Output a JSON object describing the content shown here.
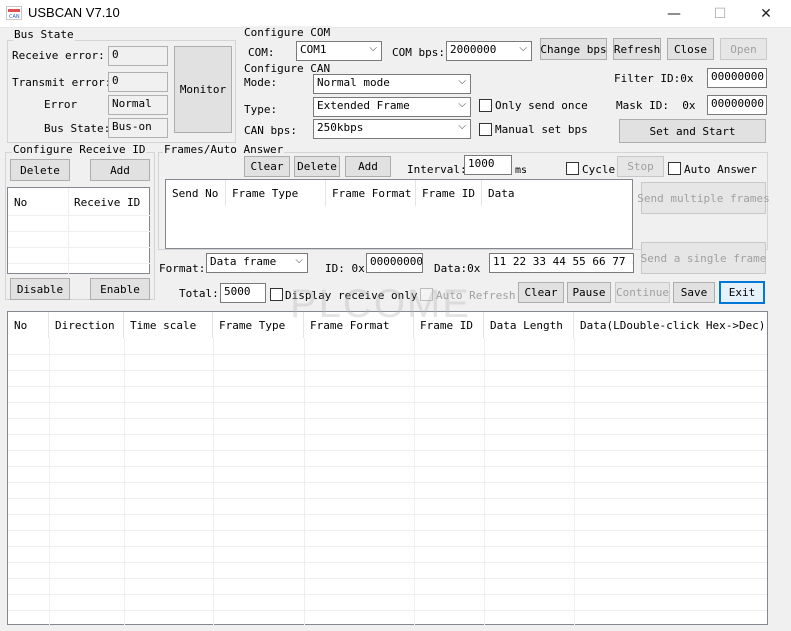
{
  "window": {
    "title": "USBCAN V7.10",
    "icon_name": "usbcan-app-icon",
    "icon_text": "CAN",
    "minimize_glyph": "—",
    "maximize_glyph": "☐",
    "close_glyph": "✕"
  },
  "bus_state": {
    "group_label": "Bus State",
    "receive_error_label": "Receive error:",
    "receive_error_value": "0",
    "transmit_error_label": "Transmit error:",
    "transmit_error_value": "0",
    "error_label": "Error",
    "error_value": "Normal",
    "bus_state_label": "Bus State:",
    "bus_state_value": "Bus-on",
    "monitor_button": "Monitor"
  },
  "configure_com": {
    "group_label": "Configure COM",
    "com_label": "COM:",
    "com_value": "COM1",
    "com_bps_label": "COM bps:",
    "com_bps_value": "2000000",
    "change_bps_button": "Change bps",
    "refresh_button": "Refresh",
    "close_button": "Close",
    "open_button": "Open"
  },
  "configure_can": {
    "group_label": "Configure CAN",
    "mode_label": "Mode:",
    "mode_value": "Normal mode",
    "type_label": "Type:",
    "type_value": "Extended Frame",
    "can_bps_label": "CAN bps:",
    "can_bps_value": "250kbps",
    "only_send_once_label": "Only send once",
    "manual_set_bps_label": "Manual set bps",
    "filter_id_label": "Filter ID:0x",
    "filter_id_value": "00000000",
    "mask_id_label": "Mask ID:  0x",
    "mask_id_value": "00000000",
    "set_and_start_button": "Set and Start"
  },
  "configure_receive_id": {
    "group_label": "Configure Receive ID",
    "delete_button": "Delete",
    "add_button": "Add",
    "columns": [
      "No",
      "Receive ID"
    ],
    "disable_button": "Disable",
    "enable_button": "Enable"
  },
  "frames_auto_answer": {
    "group_label": "Frames/Auto Answer",
    "clear_button": "Clear",
    "delete_button": "Delete",
    "add_button": "Add",
    "interval_label": "Interval:",
    "interval_value": "1000",
    "interval_unit": "ms",
    "cycle_label": "Cycle",
    "stop_button": "Stop",
    "auto_answer_label": "Auto Answer",
    "columns": [
      "Send No",
      "Frame Type",
      "Frame Format",
      "Frame ID",
      "Data"
    ],
    "send_multiple_button": "Send multiple frames",
    "send_single_button": "Send a single frame"
  },
  "send_bar": {
    "format_label": "Format:",
    "format_value": "Data frame",
    "id_label": "ID: 0x",
    "id_value": "00000000",
    "data_label": "Data:0x",
    "data_value": "11 22 33 44 55 66 77 88"
  },
  "receive_bar": {
    "total_label": "Total:",
    "total_value": "5000",
    "display_receive_only_label": "Display receive only",
    "auto_refresh_label": "Auto Refresh",
    "clear_button": "Clear",
    "pause_button": "Pause",
    "continue_button": "Continue",
    "save_button": "Save",
    "exit_button": "Exit"
  },
  "receive_table": {
    "columns": [
      "No",
      "Direction",
      "Time scale",
      "Frame Type",
      "Frame Format",
      "Frame ID",
      "Data Length",
      "Data(LDouble-click Hex->Dec)"
    ]
  },
  "watermark": "PLCOME",
  "colors": {
    "window_bg": "#f0f0f0",
    "focus_border": "#0078d7",
    "disabled_text": "#a0a0a0"
  }
}
